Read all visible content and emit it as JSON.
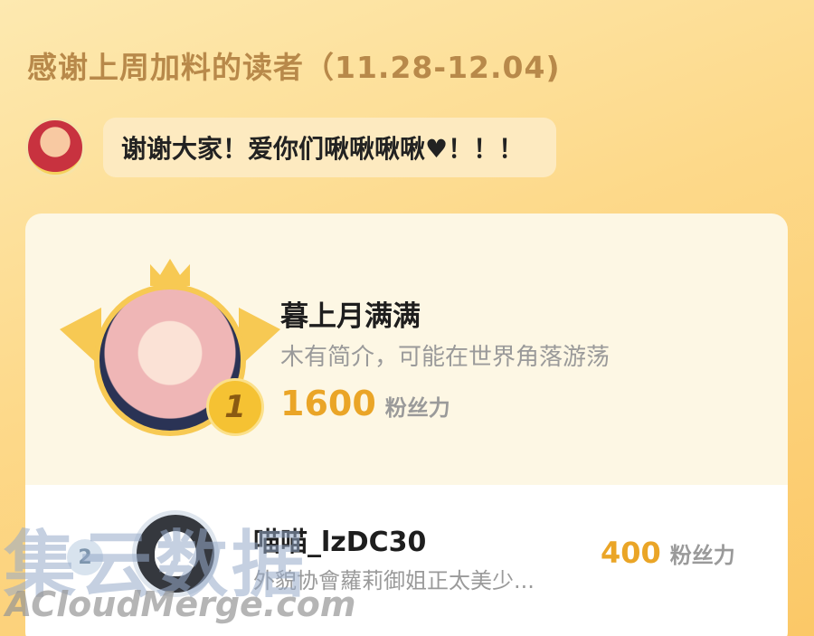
{
  "header": {
    "title": "感谢上周加料的读者（11.28-12.04)"
  },
  "message": {
    "text": "谢谢大家！爱你们啾啾啾啾♥！！！"
  },
  "ranking": [
    {
      "rank": "1",
      "name": "暮上月满满",
      "intro": "木有简介，可能在世界角落游荡",
      "score": "1600",
      "unit": "粉丝力"
    },
    {
      "rank": "2",
      "name": "喵喵_lzDC30",
      "intro": "外貌协會蘿莉御姐正太美少...",
      "score": "400",
      "unit": "粉丝力"
    }
  ],
  "watermark": {
    "cn": "集云数据",
    "en": "ACloudMerge.com"
  },
  "colors": {
    "accent": "#eaa527",
    "gold": "#f7c953",
    "title": "#b8894a"
  }
}
